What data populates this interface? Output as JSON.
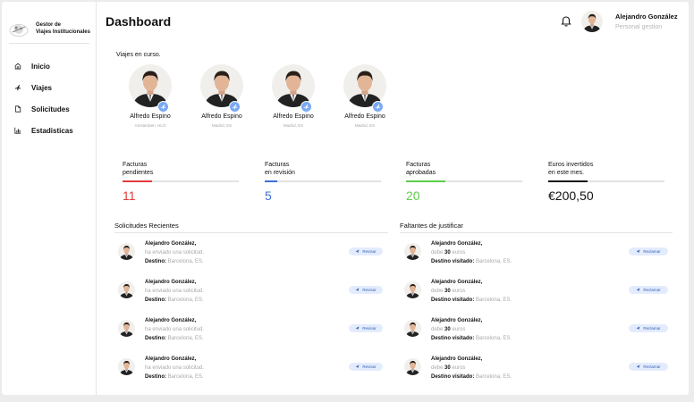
{
  "brand": {
    "line1": "Gestor de",
    "line2": "Viajes Institucionales"
  },
  "nav": [
    {
      "label": "Inicio",
      "icon": "home-icon"
    },
    {
      "label": "Viajes",
      "icon": "plane-icon"
    },
    {
      "label": "Solicitudes",
      "icon": "document-icon"
    },
    {
      "label": "Estadisticas",
      "icon": "chart-icon"
    }
  ],
  "header": {
    "title": "Dashboard",
    "user_name": "Alejandro González",
    "user_role": "Personal gestion"
  },
  "trips": {
    "heading": "Viajes en curso.",
    "items": [
      {
        "name": "Alfredo Espino",
        "place": "Amsterdam, HLO"
      },
      {
        "name": "Alfredo Espino",
        "place": "Madrid, ES"
      },
      {
        "name": "Alfredo Espino",
        "place": "Madrid, ES"
      },
      {
        "name": "Alfredo Espino",
        "place": "Madrid, ES"
      }
    ]
  },
  "stats": [
    {
      "label1": "Facturas",
      "label2": "pendientes",
      "value": "11",
      "color": "#e03c3c",
      "progress": 0.25
    },
    {
      "label1": "Facturas",
      "label2": "en revisión",
      "value": "5",
      "color": "#3d6fd6",
      "progress": 0.11
    },
    {
      "label1": "Facturas",
      "label2": "aprobadas",
      "value": "20",
      "color": "#5ccd4a",
      "progress": 0.34
    },
    {
      "label1": "Euros invertidos",
      "label2": "en este mes.",
      "value": "€200,50",
      "color": "#111111",
      "progress": 0.34
    }
  ],
  "requests": {
    "heading": "Solicitudes Recientes",
    "button": "Revisar",
    "items": [
      {
        "name": "Alejandro González,",
        "action": "ha enviado una solicitud.",
        "dest_label": "Destino:",
        "dest": "Barcelona, ES."
      },
      {
        "name": "Alejandro González,",
        "action": "ha enviado una solicitud.",
        "dest_label": "Destino:",
        "dest": "Barcelona, ES."
      },
      {
        "name": "Alejandro González,",
        "action": "ha enviado una solicitud.",
        "dest_label": "Destino:",
        "dest": "Barcelona, ES."
      },
      {
        "name": "Alejandro González,",
        "action": "ha enviado una solicitud.",
        "dest_label": "Destino:",
        "dest": "Barcelona, ES."
      }
    ]
  },
  "pending": {
    "heading": "Faltantes de justificar",
    "button": "Reclamar",
    "items": [
      {
        "name": "Alejandro González,",
        "owes_pre": "debe",
        "amount": "30",
        "owes_post": "euros",
        "dest_label": "Destino visitado:",
        "dest": "Barcelona, ES."
      },
      {
        "name": "Alejandro González,",
        "owes_pre": "debe",
        "amount": "30",
        "owes_post": "euros",
        "dest_label": "Destino visitado:",
        "dest": "Barcelona, ES."
      },
      {
        "name": "Alejandro González,",
        "owes_pre": "debe",
        "amount": "30",
        "owes_post": "euros",
        "dest_label": "Destino visitado:",
        "dest": "Barcelona, ES."
      },
      {
        "name": "Alejandro González,",
        "owes_pre": "debe",
        "amount": "30",
        "owes_post": "euros",
        "dest_label": "Destino visitado:",
        "dest": "Barcelona, ES."
      }
    ]
  }
}
